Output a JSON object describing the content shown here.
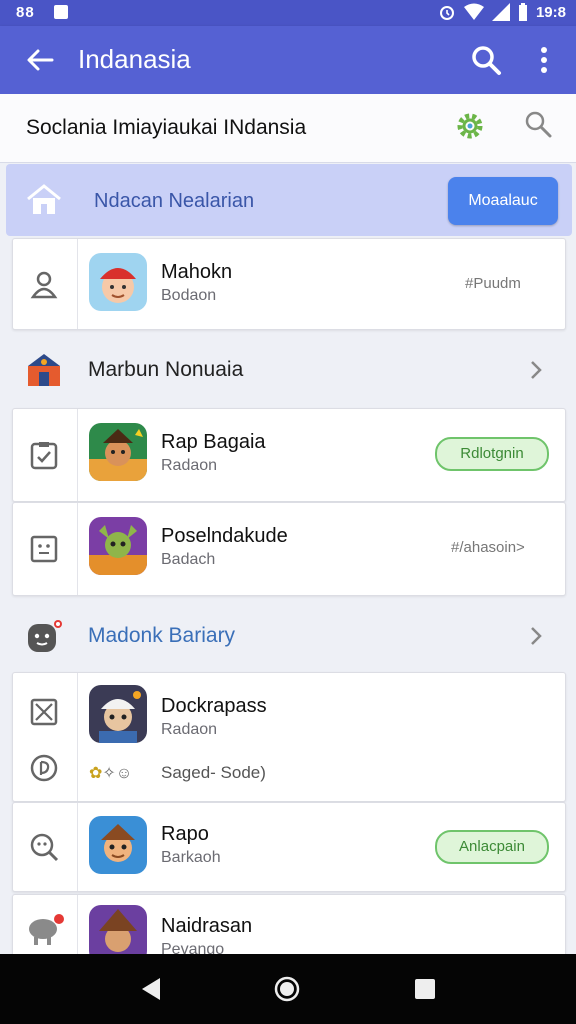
{
  "status_bar": {
    "left_text": "88",
    "time": "19:8"
  },
  "app_bar": {
    "title": "Indanasia",
    "icons": [
      "back-arrow-icon",
      "search-icon",
      "more-vert-icon"
    ]
  },
  "sub_header": {
    "text": "Soclania Imiayiaukai INdansia",
    "icons": [
      "gear-icon",
      "search-icon"
    ]
  },
  "banner": {
    "text": "Ndacan Nealarian",
    "button_label": "Moaalauc",
    "accent": "#4b82ec"
  },
  "sections": [
    {
      "title": "Marbun Nonuaia"
    },
    {
      "title": "Madonk Bariary",
      "color": "#3a6fb8"
    }
  ],
  "items": [
    {
      "name": "Mahokn",
      "subtitle": "Bodaon",
      "meta": "#Puudm",
      "icon": "boy-red-cap-app-icon"
    },
    {
      "name": "Rap Bagaia",
      "subtitle": "Radaon",
      "action": "Rdlotgnin",
      "icon": "warrior-game-app-icon"
    },
    {
      "name": "Poselndakude",
      "subtitle": "Badach",
      "meta": "#/ahasoin>",
      "icon": "goblin-game-app-icon"
    },
    {
      "name": "Dockrapass",
      "subtitle": "Radaon",
      "extra": "Saged- Sode)",
      "icon": "explorer-game-app-icon"
    },
    {
      "name": "Rapo",
      "subtitle": "Barkaoh",
      "action": "Anlacpain",
      "icon": "adventurer-game-app-icon"
    },
    {
      "name": "Naidrasan",
      "subtitle": "Pevango",
      "icon": "hat-character-app-icon"
    }
  ],
  "colors": {
    "app_bar": "#5561d3",
    "status_bar": "#4a55c6",
    "pill_green": "#6fc46b"
  }
}
